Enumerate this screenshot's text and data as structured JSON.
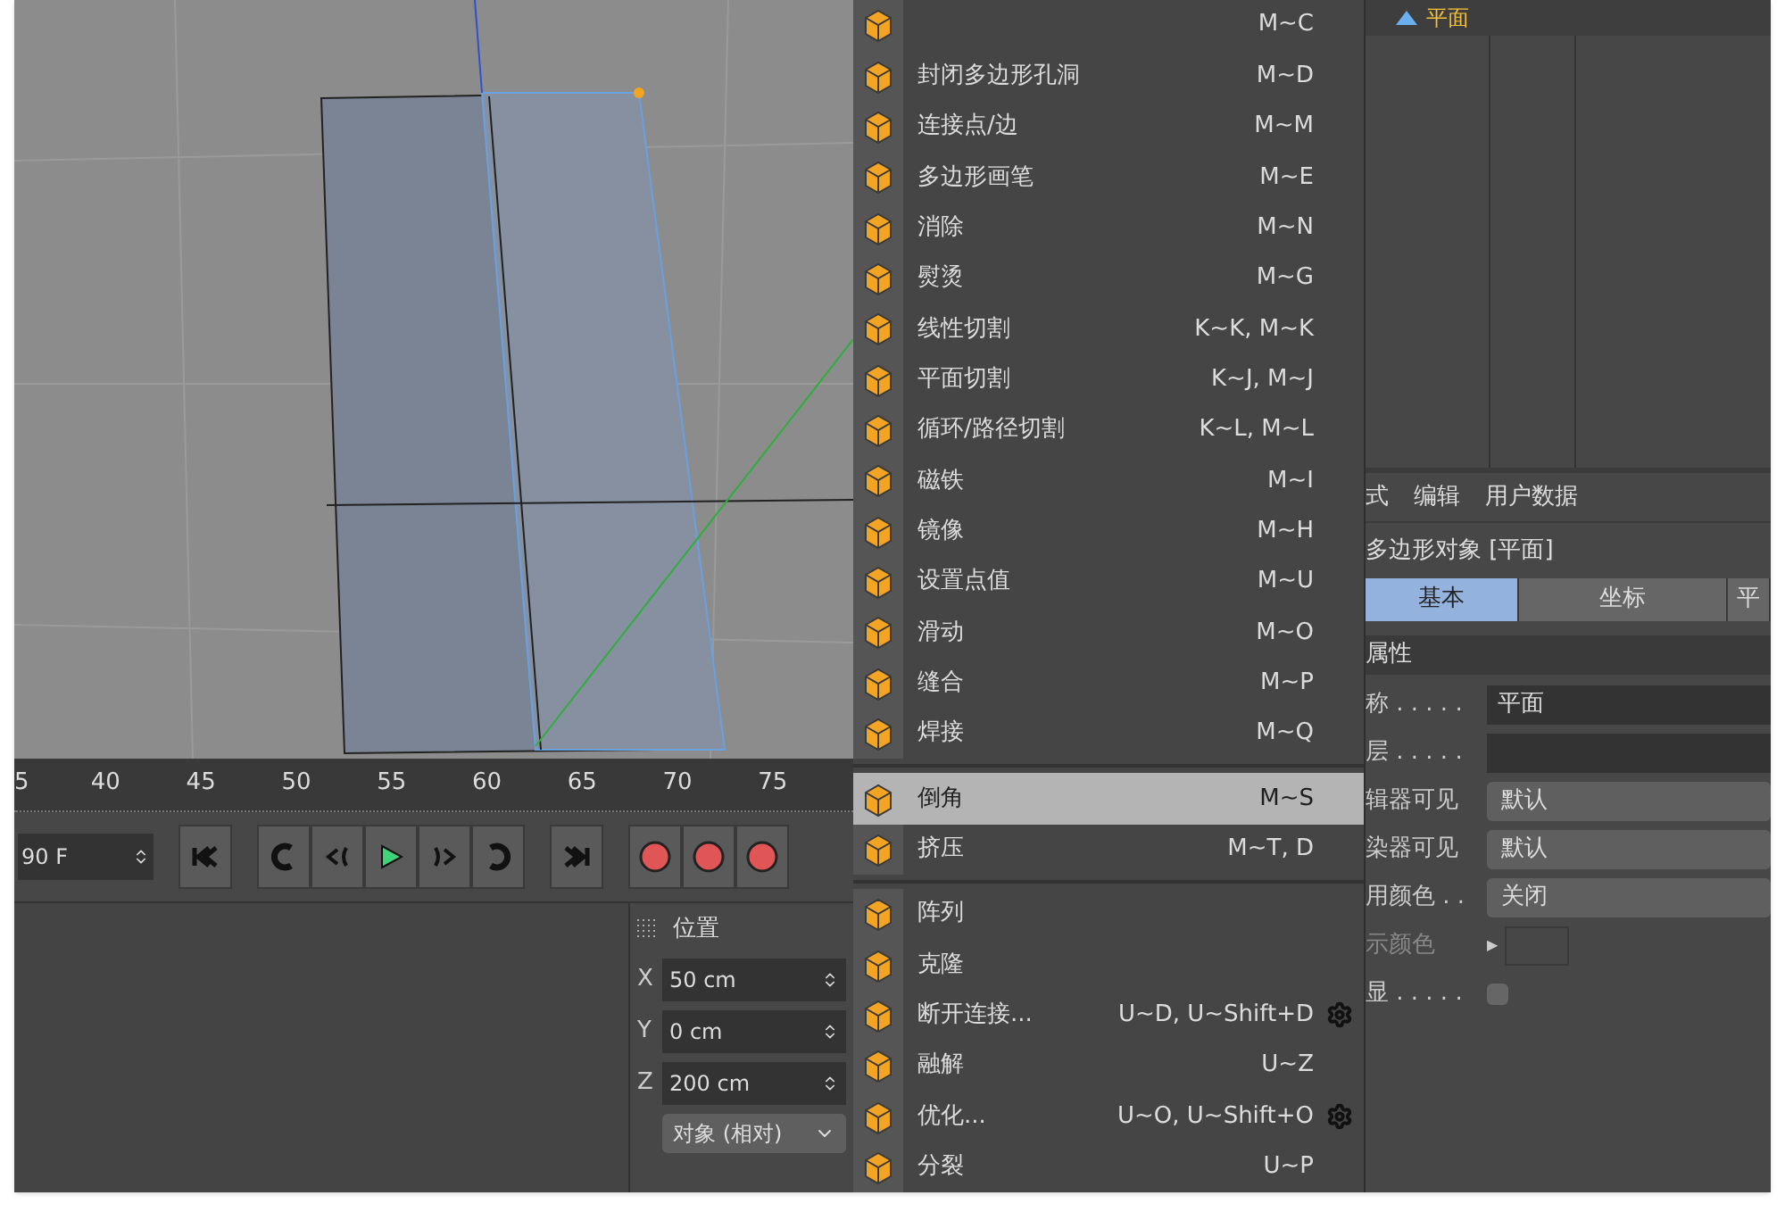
{
  "object_manager": {
    "object_name": "平面"
  },
  "timeline": {
    "ticks": [
      "5",
      "40",
      "45",
      "50",
      "55",
      "60",
      "65",
      "70",
      "75"
    ]
  },
  "transport": {
    "frame_field": "90 F"
  },
  "coordinates": {
    "title": "位置",
    "fields": [
      {
        "axis": "X",
        "value": "50 cm"
      },
      {
        "axis": "Y",
        "value": "0 cm"
      },
      {
        "axis": "Z",
        "value": "200 cm"
      }
    ],
    "mode": "对象 (相对)"
  },
  "menu": {
    "items": [
      {
        "kind": "item",
        "shortcut": "M~C",
        "selected": false,
        "options": false
      },
      {
        "kind": "item",
        "label": "封闭多边形孔洞",
        "shortcut": "M~D",
        "selected": false,
        "options": false
      },
      {
        "kind": "item",
        "label": "连接点/边",
        "shortcut": "M~M",
        "selected": false,
        "options": false
      },
      {
        "kind": "item",
        "label": "多边形画笔",
        "shortcut": "M~E",
        "selected": false,
        "options": false
      },
      {
        "kind": "item",
        "label": "消除",
        "shortcut": "M~N",
        "selected": false,
        "options": false
      },
      {
        "kind": "item",
        "label": "熨烫",
        "shortcut": "M~G",
        "selected": false,
        "options": false
      },
      {
        "kind": "item",
        "label": "线性切割",
        "shortcut": "K~K, M~K",
        "selected": false,
        "options": false
      },
      {
        "kind": "item",
        "label": "平面切割",
        "shortcut": "K~J, M~J",
        "selected": false,
        "options": false
      },
      {
        "kind": "item",
        "label": "循环/路径切割",
        "shortcut": "K~L, M~L",
        "selected": false,
        "options": false
      },
      {
        "kind": "item",
        "label": "磁铁",
        "shortcut": "M~I",
        "selected": false,
        "options": false
      },
      {
        "kind": "item",
        "label": "镜像",
        "shortcut": "M~H",
        "selected": false,
        "options": false
      },
      {
        "kind": "item",
        "label": "设置点值",
        "shortcut": "M~U",
        "selected": false,
        "options": false
      },
      {
        "kind": "item",
        "label": "滑动",
        "shortcut": "M~O",
        "selected": false,
        "options": false
      },
      {
        "kind": "item",
        "label": "缝合",
        "shortcut": "M~P",
        "selected": false,
        "options": false
      },
      {
        "kind": "item",
        "label": "焊接",
        "shortcut": "M~Q",
        "selected": false,
        "options": false
      },
      {
        "kind": "separator"
      },
      {
        "kind": "item",
        "label": "倒角",
        "shortcut": "M~S",
        "selected": true,
        "options": false
      },
      {
        "kind": "item",
        "label": "挤压",
        "shortcut": "M~T, D",
        "selected": false,
        "options": false
      },
      {
        "kind": "separator"
      },
      {
        "kind": "item",
        "label": "阵列",
        "selected": false,
        "options": false
      },
      {
        "kind": "item",
        "label": "克隆",
        "selected": false,
        "options": false
      },
      {
        "kind": "item",
        "label": "断开连接...",
        "shortcut": "U~D, U~Shift+D",
        "selected": false,
        "options": true
      },
      {
        "kind": "item",
        "label": "融解",
        "shortcut": "U~Z",
        "selected": false,
        "options": false
      },
      {
        "kind": "item",
        "label": "优化...",
        "shortcut": "U~O, U~Shift+O",
        "selected": false,
        "options": true
      },
      {
        "kind": "item",
        "label": "分裂",
        "shortcut": "U~P",
        "selected": false,
        "options": false
      }
    ]
  },
  "attributes": {
    "menu": [
      "式",
      "编辑",
      "用户数据"
    ],
    "title": "多边形对象 [平面]",
    "tabs": [
      {
        "label": "基本",
        "selected": true
      },
      {
        "label": "坐标",
        "selected": false
      },
      {
        "label": "平",
        "selected": false
      }
    ],
    "section": "属性",
    "rows": [
      {
        "kind": "text",
        "label": "称 . . . . .",
        "value": "平面"
      },
      {
        "kind": "text",
        "label": "层 . . . . ."
      },
      {
        "kind": "dropdown",
        "label": "辑器可见",
        "value": "默认"
      },
      {
        "kind": "dropdown",
        "label": "染器可见",
        "value": "默认"
      },
      {
        "kind": "dropdown",
        "label": "用颜色 . .",
        "value": "关闭"
      },
      {
        "kind": "color",
        "label": "示颜色",
        "glyph": "▶"
      },
      {
        "kind": "checkbox",
        "label": "显 . . . . .",
        "checked": false
      }
    ]
  }
}
